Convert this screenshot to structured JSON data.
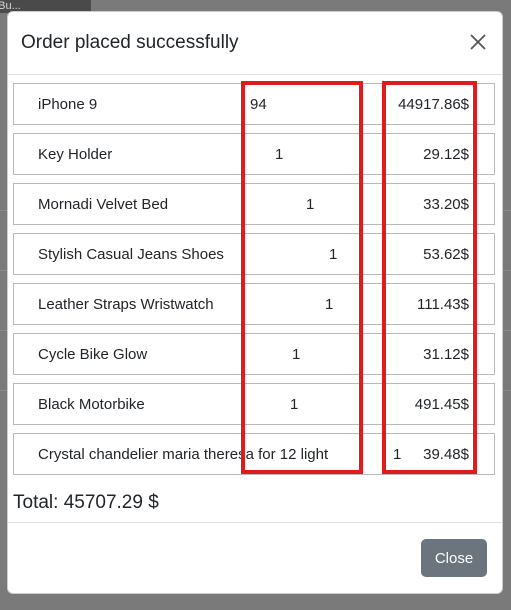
{
  "backdrop": {
    "tab_text": "eBu..."
  },
  "modal": {
    "title": "Order placed successfully",
    "close_label": "Close",
    "total": "Total: 45707.29 $"
  },
  "items": [
    {
      "name": "iPhone 9",
      "qty": "94",
      "price": "44917.86$"
    },
    {
      "name": "Key Holder",
      "qty": "1",
      "price": "29.12$"
    },
    {
      "name": "Mornadi Velvet Bed",
      "qty": "1",
      "price": "33.20$"
    },
    {
      "name": "Stylish Casual Jeans Shoes",
      "qty": "1",
      "price": "53.62$"
    },
    {
      "name": "Leather Straps Wristwatch",
      "qty": "1",
      "price": "111.43$"
    },
    {
      "name": "Cycle Bike Glow",
      "qty": "1",
      "price": "31.12$"
    },
    {
      "name": "Black Motorbike",
      "qty": "1",
      "price": "491.45$"
    },
    {
      "name": "Crystal chandelier maria theresa for 12 light",
      "qty": "1",
      "price": "39.48$"
    }
  ],
  "colors": {
    "highlight": "#e01b1b",
    "close_button": "#6c757d",
    "backdrop": "#7a7a7a"
  },
  "icons": {
    "close": "close-icon"
  }
}
